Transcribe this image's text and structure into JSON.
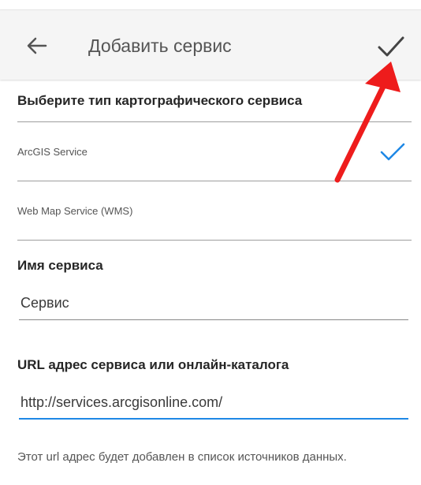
{
  "app_bar": {
    "back_icon": "arrow-left-icon",
    "title": "Добавить сервис",
    "confirm_icon": "checkmark-icon"
  },
  "service_type": {
    "heading": "Выберите тип картографического сервиса",
    "options": [
      {
        "label": "ArcGIS Service",
        "selected": true
      },
      {
        "label": "Web Map Service (WMS)",
        "selected": false
      }
    ],
    "selected_color": "#1e88e5"
  },
  "service_name": {
    "heading": "Имя сервиса",
    "value": "Сервис"
  },
  "service_url": {
    "heading": "URL адрес сервиса или онлайн-каталога",
    "value": "http://services.arcgisonline.com/",
    "focus_color": "#1e88e5",
    "helper": "Этот url адрес будет добавлен в список источников данных."
  },
  "annotation": {
    "arrow_color": "#ee1c1c"
  }
}
